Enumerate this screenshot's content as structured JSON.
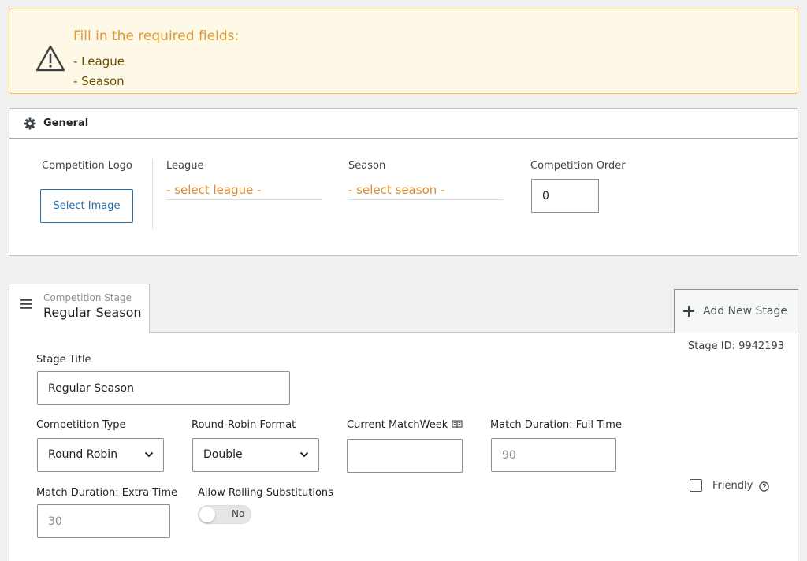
{
  "alert": {
    "title": "Fill in the required fields:",
    "fields": [
      "- League",
      "- Season"
    ]
  },
  "general": {
    "title": "General",
    "logo_label": "Competition Logo",
    "select_image_label": "Select Image",
    "league_label": "League",
    "league_value": "- select league -",
    "season_label": "Season",
    "season_value": "- select season -",
    "order_label": "Competition Order",
    "order_value": "0"
  },
  "stage": {
    "tab_small": "Competition Stage",
    "tab_title": "Regular Season",
    "add_label": "Add New Stage",
    "stage_id": "Stage ID: 9942193",
    "stage_title_label": "Stage Title",
    "stage_title_value": "Regular Season",
    "competition_type_label": "Competition Type",
    "competition_type_value": "Round Robin",
    "rr_format_label": "Round-Robin Format",
    "rr_format_value": "Double",
    "matchweek_label": "Current MatchWeek",
    "matchweek_value": "",
    "full_time_label": "Match Duration: Full Time",
    "full_time_value": "90",
    "extra_time_label": "Match Duration: Extra Time",
    "extra_time_value": "30",
    "rolling_label": "Allow Rolling Substitutions",
    "rolling_value": "No",
    "friendly_label": "Friendly"
  },
  "colors": {
    "accent": "#2271b1",
    "warning_border": "#f0c33c",
    "warning_bg": "#fef8e7",
    "warning_title": "#dd9933"
  },
  "icons": [
    "warning-icon",
    "gear-icon",
    "menu-icon",
    "plus-icon",
    "chevron-down-icon",
    "book-icon",
    "help-icon"
  ]
}
